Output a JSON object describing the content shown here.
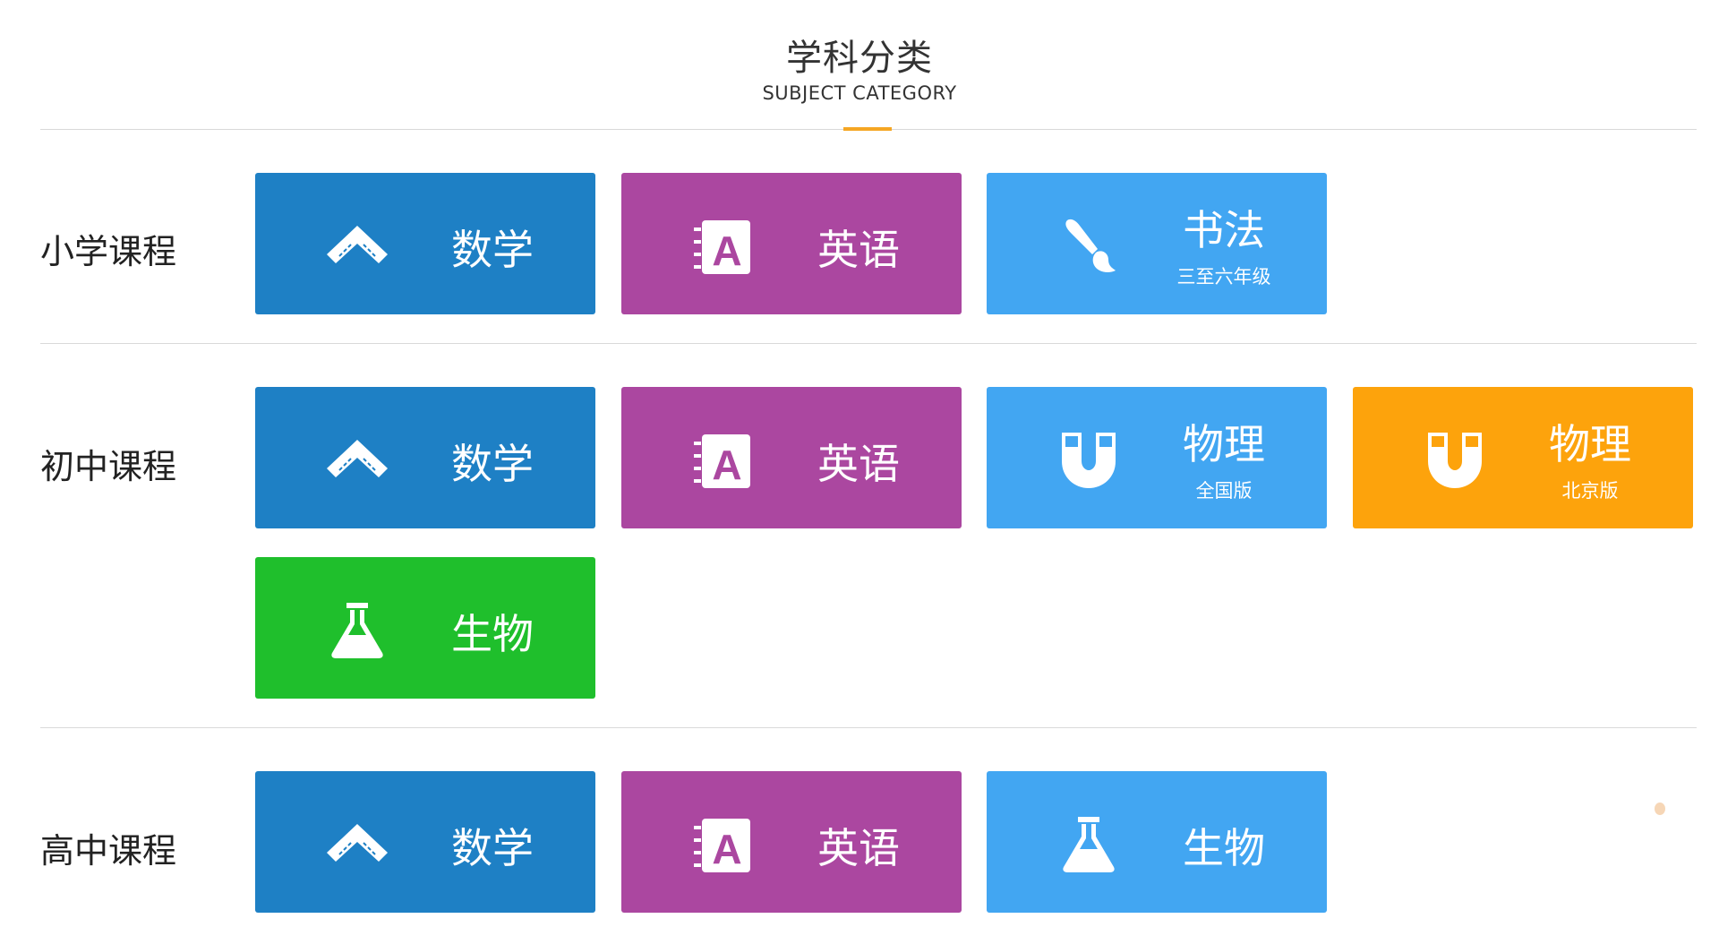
{
  "header": {
    "title": "学科分类",
    "subtitle": "SUBJECT CATEGORY"
  },
  "colors": {
    "accent": "#f5a623",
    "math": "#1e80c5",
    "english": "#ab47a0",
    "light": "#42a6f2",
    "orange": "#fda30c",
    "green": "#1fbf2c"
  },
  "sections": [
    {
      "label": "小学课程",
      "tiles": [
        {
          "name": "数学",
          "icon": "ruler-icon"
        },
        {
          "name": "英语",
          "icon": "english-book-icon"
        },
        {
          "name": "书法",
          "sub": "三至六年级",
          "icon": "brush-icon"
        }
      ]
    },
    {
      "label": "初中课程",
      "tiles": [
        {
          "name": "数学",
          "icon": "ruler-icon"
        },
        {
          "name": "英语",
          "icon": "english-book-icon"
        },
        {
          "name": "物理",
          "sub": "全国版",
          "icon": "magnet-icon"
        },
        {
          "name": "物理",
          "sub": "北京版",
          "icon": "magnet-icon"
        },
        {
          "name": "生物",
          "icon": "flask-icon"
        }
      ]
    },
    {
      "label": "高中课程",
      "tiles": [
        {
          "name": "数学",
          "icon": "ruler-icon"
        },
        {
          "name": "英语",
          "icon": "english-book-icon"
        },
        {
          "name": "生物",
          "icon": "flask-icon"
        }
      ]
    }
  ]
}
